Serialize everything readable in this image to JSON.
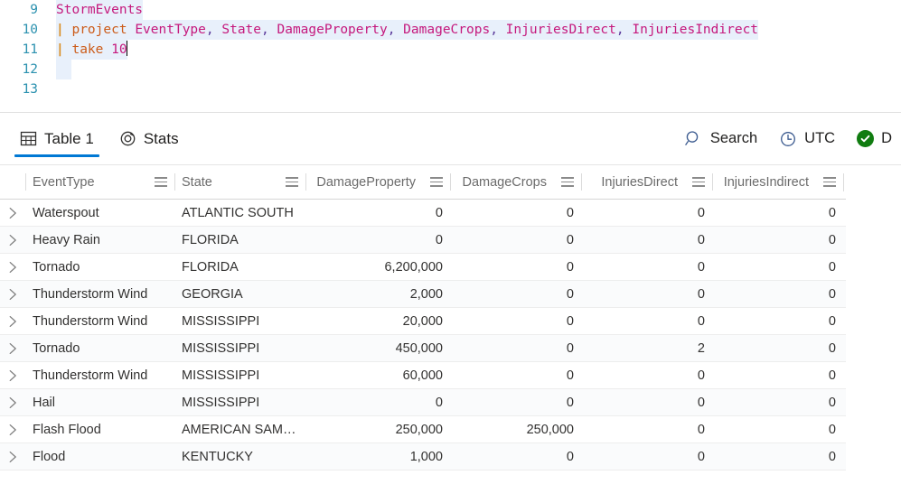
{
  "editor": {
    "lines": [
      {
        "number": "9",
        "highlighted": true,
        "tokens": [
          {
            "t": "StormEvents",
            "c": "tok-table"
          }
        ]
      },
      {
        "number": "10",
        "highlighted": true,
        "tokens": [
          {
            "t": "| ",
            "c": "tok-pipe"
          },
          {
            "t": "project ",
            "c": "tok-kw"
          },
          {
            "t": "EventType",
            "c": "tok-col"
          },
          {
            "t": ", ",
            "c": "tok-punc"
          },
          {
            "t": "State",
            "c": "tok-col"
          },
          {
            "t": ", ",
            "c": "tok-punc"
          },
          {
            "t": "DamageProperty",
            "c": "tok-col"
          },
          {
            "t": ", ",
            "c": "tok-punc"
          },
          {
            "t": "DamageCrops",
            "c": "tok-col"
          },
          {
            "t": ", ",
            "c": "tok-punc"
          },
          {
            "t": "InjuriesDirect",
            "c": "tok-col"
          },
          {
            "t": ", ",
            "c": "tok-punc"
          },
          {
            "t": "InjuriesIndirect",
            "c": "tok-col"
          }
        ]
      },
      {
        "number": "11",
        "highlighted": true,
        "caret": true,
        "tokens": [
          {
            "t": "| ",
            "c": "tok-pipe"
          },
          {
            "t": "take ",
            "c": "tok-kw"
          },
          {
            "t": "10",
            "c": "tok-num"
          }
        ]
      },
      {
        "number": "12",
        "highlighted": true,
        "tokens": []
      },
      {
        "number": "13",
        "highlighted": false,
        "tokens": []
      }
    ]
  },
  "results": {
    "tabs": [
      {
        "label": "Table 1",
        "icon": "table-icon",
        "active": true
      },
      {
        "label": "Stats",
        "icon": "donut-icon",
        "active": false
      }
    ],
    "toolbar_right": [
      {
        "label": "Search",
        "icon": "search-icon"
      },
      {
        "label": "UTC",
        "icon": "clock-icon"
      },
      {
        "label": "D",
        "icon": "success-check-icon"
      }
    ],
    "columns": [
      {
        "key": "EventType",
        "label": "EventType",
        "align": "left"
      },
      {
        "key": "State",
        "label": "State",
        "align": "left"
      },
      {
        "key": "DamageProperty",
        "label": "DamageProperty",
        "align": "right"
      },
      {
        "key": "DamageCrops",
        "label": "DamageCrops",
        "align": "right"
      },
      {
        "key": "InjuriesDirect",
        "label": "InjuriesDirect",
        "align": "right"
      },
      {
        "key": "InjuriesIndirect",
        "label": "InjuriesIndirect",
        "align": "right"
      }
    ],
    "rows": [
      {
        "EventType": "Waterspout",
        "State": "ATLANTIC SOUTH",
        "DamageProperty": "0",
        "DamageCrops": "0",
        "InjuriesDirect": "0",
        "InjuriesIndirect": "0"
      },
      {
        "EventType": "Heavy Rain",
        "State": "FLORIDA",
        "DamageProperty": "0",
        "DamageCrops": "0",
        "InjuriesDirect": "0",
        "InjuriesIndirect": "0"
      },
      {
        "EventType": "Tornado",
        "State": "FLORIDA",
        "DamageProperty": "6,200,000",
        "DamageCrops": "0",
        "InjuriesDirect": "0",
        "InjuriesIndirect": "0"
      },
      {
        "EventType": "Thunderstorm Wind",
        "State": "GEORGIA",
        "DamageProperty": "2,000",
        "DamageCrops": "0",
        "InjuriesDirect": "0",
        "InjuriesIndirect": "0"
      },
      {
        "EventType": "Thunderstorm Wind",
        "State": "MISSISSIPPI",
        "DamageProperty": "20,000",
        "DamageCrops": "0",
        "InjuriesDirect": "0",
        "InjuriesIndirect": "0"
      },
      {
        "EventType": "Tornado",
        "State": "MISSISSIPPI",
        "DamageProperty": "450,000",
        "DamageCrops": "0",
        "InjuriesDirect": "2",
        "InjuriesIndirect": "0"
      },
      {
        "EventType": "Thunderstorm Wind",
        "State": "MISSISSIPPI",
        "DamageProperty": "60,000",
        "DamageCrops": "0",
        "InjuriesDirect": "0",
        "InjuriesIndirect": "0"
      },
      {
        "EventType": "Hail",
        "State": "MISSISSIPPI",
        "DamageProperty": "0",
        "DamageCrops": "0",
        "InjuriesDirect": "0",
        "InjuriesIndirect": "0"
      },
      {
        "EventType": "Flash Flood",
        "State": "AMERICAN SAM…",
        "DamageProperty": "250,000",
        "DamageCrops": "250,000",
        "InjuriesDirect": "0",
        "InjuriesIndirect": "0"
      },
      {
        "EventType": "Flood",
        "State": "KENTUCKY",
        "DamageProperty": "1,000",
        "DamageCrops": "0",
        "InjuriesDirect": "0",
        "InjuriesIndirect": "0"
      }
    ]
  },
  "colors": {
    "accent": "#0078d4",
    "success": "#107c10",
    "keyword": "#cc5c1a",
    "entity": "#c5197d",
    "line_number": "#2b91af",
    "code_highlight": "#e8f0fb"
  }
}
